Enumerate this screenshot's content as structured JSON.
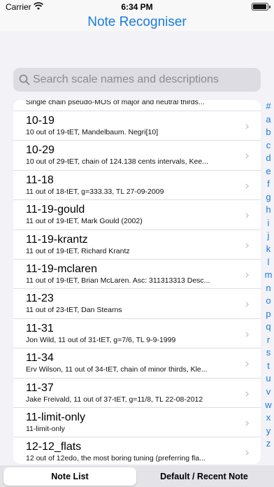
{
  "status_bar": {
    "carrier": "Carrier",
    "time": "6:34 PM",
    "battery_level": 0.95
  },
  "nav": {
    "title": "Note Recogniser"
  },
  "search": {
    "placeholder": "Search scale names and descriptions",
    "value": ""
  },
  "list": {
    "partial_top": "Single chain pseudo-MOS of major and neutral thirds...",
    "items": [
      {
        "title": "10-19",
        "subtitle": "10 out of 19-tET, Mandelbaum. Negri[10]"
      },
      {
        "title": "10-29",
        "subtitle": "10 out of 29-tET, chain of 124.138 cents intervals, Kee..."
      },
      {
        "title": "11-18",
        "subtitle": "11 out of 18-tET, g=333.33, TL 27-09-2009"
      },
      {
        "title": "11-19-gould",
        "subtitle": "11 out of 19-tET, Mark Gould (2002)"
      },
      {
        "title": "11-19-krantz",
        "subtitle": "11 out of 19-tET, Richard Krantz"
      },
      {
        "title": "11-19-mclaren",
        "subtitle": "11 out of 19-tET, Brian McLaren. Asc: 311313313 Desc..."
      },
      {
        "title": "11-23",
        "subtitle": "11 out of 23-tET, Dan Stearns"
      },
      {
        "title": "11-31",
        "subtitle": "Jon Wild, 11 out of 31-tET, g=7/6, TL 9-9-1999"
      },
      {
        "title": "11-34",
        "subtitle": "Erv Wilson, 11 out of 34-tET, chain of minor thirds, Kle..."
      },
      {
        "title": "11-37",
        "subtitle": "Jake Freivald, 11 out of 37-tET, g=11/8, TL 22-08-2012"
      },
      {
        "title": "11-limit-only",
        "subtitle": "11-limit-only"
      },
      {
        "title": "12-12_flats",
        "subtitle": "12 out of 12edo, the most boring tuning (preferring fla..."
      }
    ],
    "chevron": "›"
  },
  "index": [
    "#",
    "a",
    "b",
    "c",
    "d",
    "e",
    "f",
    "g",
    "h",
    "i",
    "j",
    "k",
    "l",
    "m",
    "n",
    "o",
    "p",
    "q",
    "r",
    "s",
    "t",
    "u",
    "v",
    "w",
    "x",
    "y",
    "z"
  ],
  "tabs": {
    "left": "Note List",
    "right": "Default / Recent Note",
    "selected": "left"
  },
  "colors": {
    "accent": "#1a7be0",
    "background": "#f2f2f7"
  }
}
